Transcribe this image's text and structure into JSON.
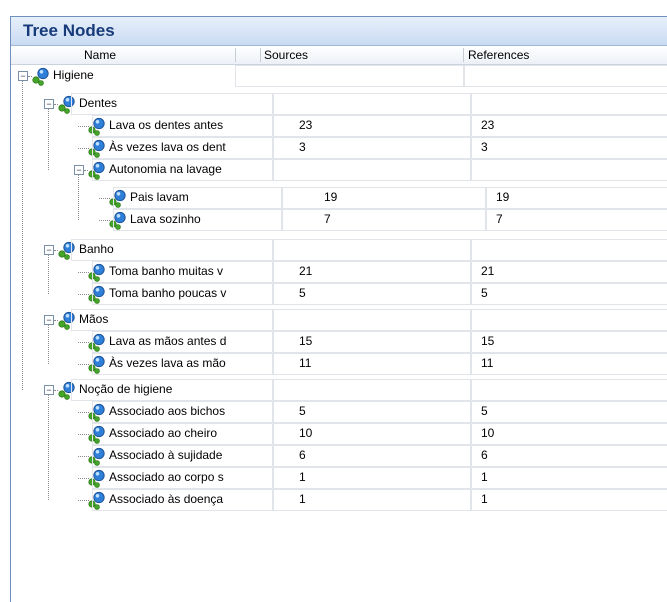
{
  "panel": {
    "title": "Tree Nodes"
  },
  "columns": {
    "name": "Name",
    "sources": "Sources",
    "references": "References"
  },
  "root": {
    "name": "Higiene"
  },
  "groups": [
    {
      "name": "Dentes",
      "children": [
        {
          "name": "Lava os dentes antes",
          "sources": "23",
          "references": "23"
        },
        {
          "name": "Às vezes lava os dent",
          "sources": "3",
          "references": "3"
        },
        {
          "name": "Autonomia na lavage",
          "children": [
            {
              "name": "Pais lavam",
              "sources": "19",
              "references": "19"
            },
            {
              "name": "Lava sozinho",
              "sources": "7",
              "references": "7"
            }
          ]
        }
      ]
    },
    {
      "name": "Banho",
      "children": [
        {
          "name": "Toma banho muitas v",
          "sources": "21",
          "references": "21"
        },
        {
          "name": "Toma banho poucas v",
          "sources": "5",
          "references": "5"
        }
      ]
    },
    {
      "name": "Mãos",
      "children": [
        {
          "name": "Lava as mãos antes d",
          "sources": "15",
          "references": "15"
        },
        {
          "name": "Às vezes lava as mão",
          "sources": "11",
          "references": "11"
        }
      ]
    },
    {
      "name": "Noção de higiene",
      "children": [
        {
          "name": "Associado aos bichos",
          "sources": "5",
          "references": "5"
        },
        {
          "name": "Associado ao cheiro",
          "sources": "10",
          "references": "10"
        },
        {
          "name": "Associado à sujidade",
          "sources": "6",
          "references": "6"
        },
        {
          "name": "Associado ao corpo s",
          "sources": "1",
          "references": "1"
        },
        {
          "name": "Associado às doença",
          "sources": "1",
          "references": "1"
        }
      ]
    }
  ],
  "colors": {
    "title_text": "#173a7a",
    "node_blue": "#2f7fd8",
    "node_green": "#45a52b"
  }
}
